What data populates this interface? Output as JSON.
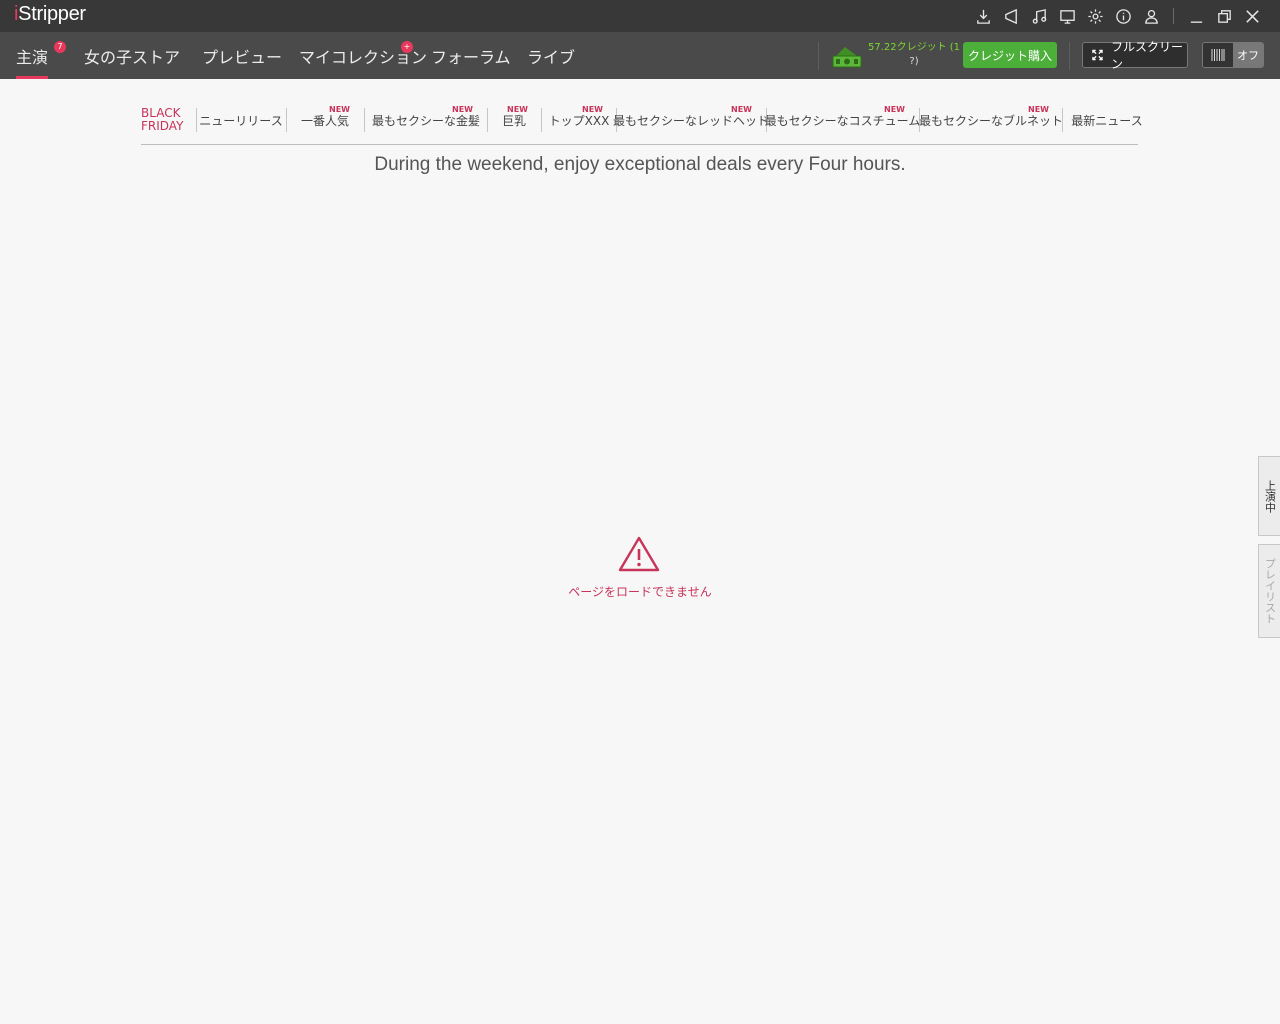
{
  "app": {
    "title_prefix": "i",
    "title_rest": "Stripper"
  },
  "titlebar": {
    "icons": [
      "download-icon",
      "announcement-icon",
      "music-icon",
      "monitor-icon",
      "settings-gear-icon",
      "info-icon",
      "user-icon"
    ],
    "window_controls": [
      "minimize-icon",
      "restore-icon",
      "close-icon"
    ]
  },
  "nav": {
    "items": [
      {
        "label": "主演",
        "badge": "7",
        "active": true
      },
      {
        "label": "女の子ストア"
      },
      {
        "label": "プレビュー"
      },
      {
        "label": "マイコレクション",
        "badge": "+"
      },
      {
        "label": "フォーラム"
      },
      {
        "label": "ライブ"
      }
    ],
    "credits": {
      "line1": "57.22クレジット (1",
      "line2": "?)"
    },
    "buy_credits": "クレジット購入",
    "fullscreen": "フルスクリーン",
    "toggle_state": "オフ"
  },
  "subtabs": [
    {
      "label": "BLACK FRIDAY",
      "line1": "BLACK",
      "line2": "FRIDAY"
    },
    {
      "label": "ニューリリース"
    },
    {
      "label": "一番人気",
      "new": "NEW"
    },
    {
      "label": "最もセクシーな金髪",
      "new": "NEW"
    },
    {
      "label": "巨乳",
      "new": "NEW"
    },
    {
      "label": "トップXXX",
      "new": "NEW"
    },
    {
      "label": "最もセクシーなレッドヘッド",
      "new": "NEW"
    },
    {
      "label": "最もセクシーなコスチューム",
      "new": "NEW"
    },
    {
      "label": "最もセクシーなブルネット",
      "new": "NEW"
    },
    {
      "label": "最新ニュース"
    }
  ],
  "headline": "During the weekend, enjoy exceptional deals every Four hours.",
  "error": {
    "message": "ページをロードできません",
    "icon": "warning-triangle-icon"
  },
  "side_tabs": [
    {
      "label": "上演中"
    },
    {
      "label": "プレイリスト"
    }
  ],
  "colors": {
    "accent": "#e8395c",
    "green": "#4caf3a",
    "titlebar": "#383838",
    "navbar": "#4a4a4a"
  }
}
